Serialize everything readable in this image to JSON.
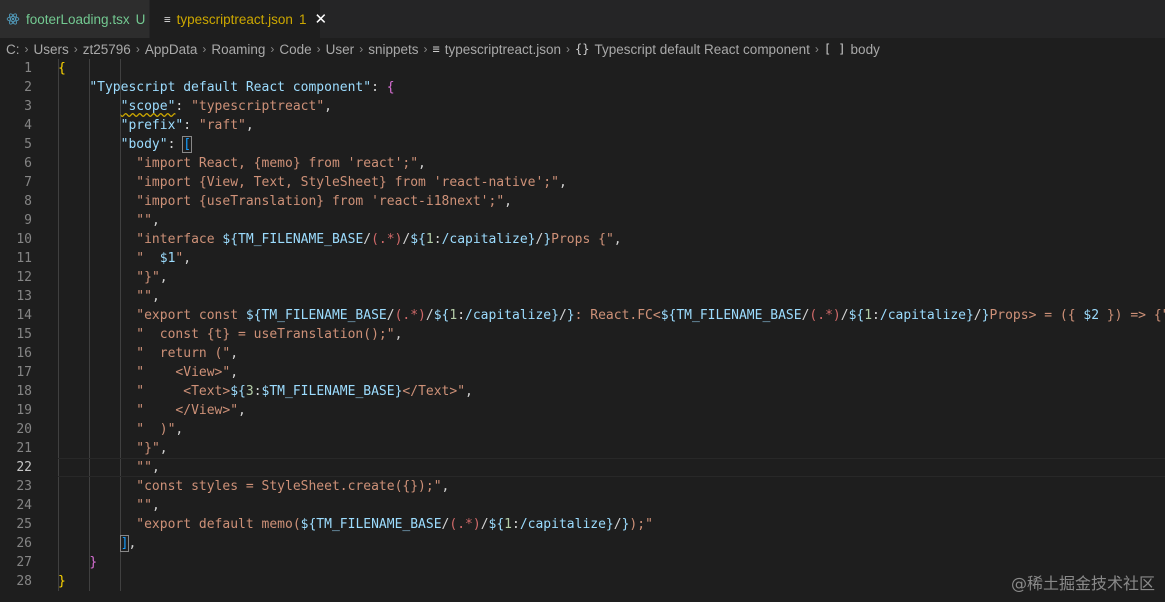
{
  "tabs": [
    {
      "name": "footerLoading.tsx",
      "badge": "U",
      "active": false
    },
    {
      "name": "typescriptreact.json",
      "badge": "1",
      "active": true
    }
  ],
  "breadcrumbs": [
    "C:",
    "Users",
    "zt25796",
    "AppData",
    "Roaming",
    "Code",
    "User",
    "snippets",
    "typescriptreact.json",
    "Typescript default React component",
    "body"
  ],
  "breadcrumb_icons": {
    "file": "file-lines-icon",
    "object": "braces-icon",
    "array": "brackets-icon"
  },
  "line_numbers": [
    "1",
    "2",
    "3",
    "4",
    "5",
    "6",
    "7",
    "8",
    "9",
    "10",
    "11",
    "12",
    "13",
    "14",
    "15",
    "16",
    "17",
    "18",
    "19",
    "20",
    "21",
    "22",
    "23",
    "24",
    "25",
    "26",
    "27",
    "28"
  ],
  "current_line": 22,
  "code": [
    "{",
    "    \"Typescript default React component\": {",
    "        \"scope\": \"typescriptreact\",",
    "        \"prefix\": \"raft\",",
    "        \"body\": [",
    "          \"import React, {memo} from 'react';\",",
    "          \"import {View, Text, StyleSheet} from 'react-native';\",",
    "          \"import {useTranslation} from 'react-i18next';\",",
    "          \"\",",
    "          \"interface ${TM_FILENAME_BASE/(.*)/${1:/capitalize}/}Props {\",",
    "          \"  $1\",",
    "          \"}\",",
    "          \"\",",
    "          \"export const ${TM_FILENAME_BASE/(.*)/${1:/capitalize}/}: React.FC<${TM_FILENAME_BASE/(.*)/${1:/capitalize}/}Props> = ({ $2 }) => {\",",
    "          \"  const {t} = useTranslation();\",",
    "          \"  return (\",",
    "          \"    <View>\",",
    "          \"     <Text>${3:$TM_FILENAME_BASE}</Text>\",",
    "          \"    </View>\",",
    "          \"  )\",",
    "          \"}\",",
    "          \"\",",
    "          \"const styles = StyleSheet.create({});\",",
    "          \"\",",
    "          \"export default memo(${TM_FILENAME_BASE/(.*)/${1:/capitalize}/});\"",
    "        ],",
    "    }",
    "}"
  ],
  "watermark": "@稀土掘金技术社区",
  "colors": {
    "background": "#1e1e1e",
    "tab_inactive_bg": "#2d2d2d",
    "untracked_green": "#73c991",
    "warning_yellow": "#cca700",
    "property_blue": "#9cdcfe",
    "string_orange": "#ce9178",
    "regex_red": "#d16969",
    "number_green": "#b5cea8",
    "bracket_gold": "#ffd700",
    "bracket_orchid": "#da70d6",
    "bracket_blue": "#179fff",
    "line_number_gray": "#858585"
  }
}
